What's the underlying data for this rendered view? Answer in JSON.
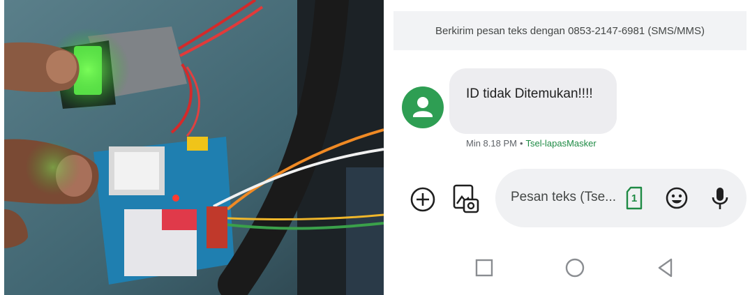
{
  "header": {
    "text": "Berkirim pesan teks dengan 0853-2147-6981 (SMS/MMS)"
  },
  "message": {
    "text": "ID tidak Ditemukan!!!!",
    "time": "Min 8.18 PM",
    "separator": "•",
    "sim_label": "Tsel-lapasMasker"
  },
  "composer": {
    "placeholder": "Pesan teks (Tse...",
    "sim_slot": "1"
  },
  "icons": [
    "add-icon",
    "gallery-icon",
    "sim-card-icon",
    "emoji-icon",
    "microphone-icon",
    "recents-icon",
    "home-icon",
    "back-icon"
  ],
  "colors": {
    "accent_green": "#1e8a44",
    "avatar_green": "#2e9e53",
    "bubble_gray": "#ededf0"
  }
}
